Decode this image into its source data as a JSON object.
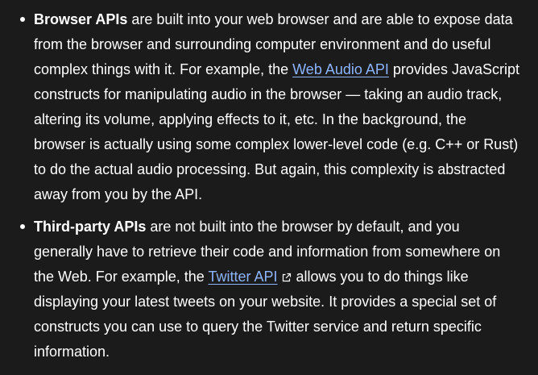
{
  "items": [
    {
      "term": "Browser APIs",
      "text_before": " are built into your web browser and are able to expose data from the browser and surrounding computer environment and do useful complex things with it. For example, the ",
      "link_text": "Web Audio API",
      "text_after": " provides JavaScript constructs for manipulating audio in the browser — taking an audio track, altering its volume, applying effects to it, etc. In the background, the browser is actually using some complex lower-level code (e.g. C++ or Rust) to do the actual audio processing. But again, this complexity is abstracted away from you by the API."
    },
    {
      "term": "Third-party APIs",
      "text_before": " are not built into the browser by default, and you generally have to retrieve their code and information from somewhere on the Web. For example, the ",
      "link_text": "Twitter API",
      "link_icon": "external-link-icon",
      "text_after": " allows you to do things like displaying your latest tweets on your website. It provides a special set of constructs you can use to query the Twitter service and return specific information."
    }
  ],
  "colors": {
    "background": "#1b1b1b",
    "text": "#ffffff",
    "link": "#8cb4ff"
  }
}
